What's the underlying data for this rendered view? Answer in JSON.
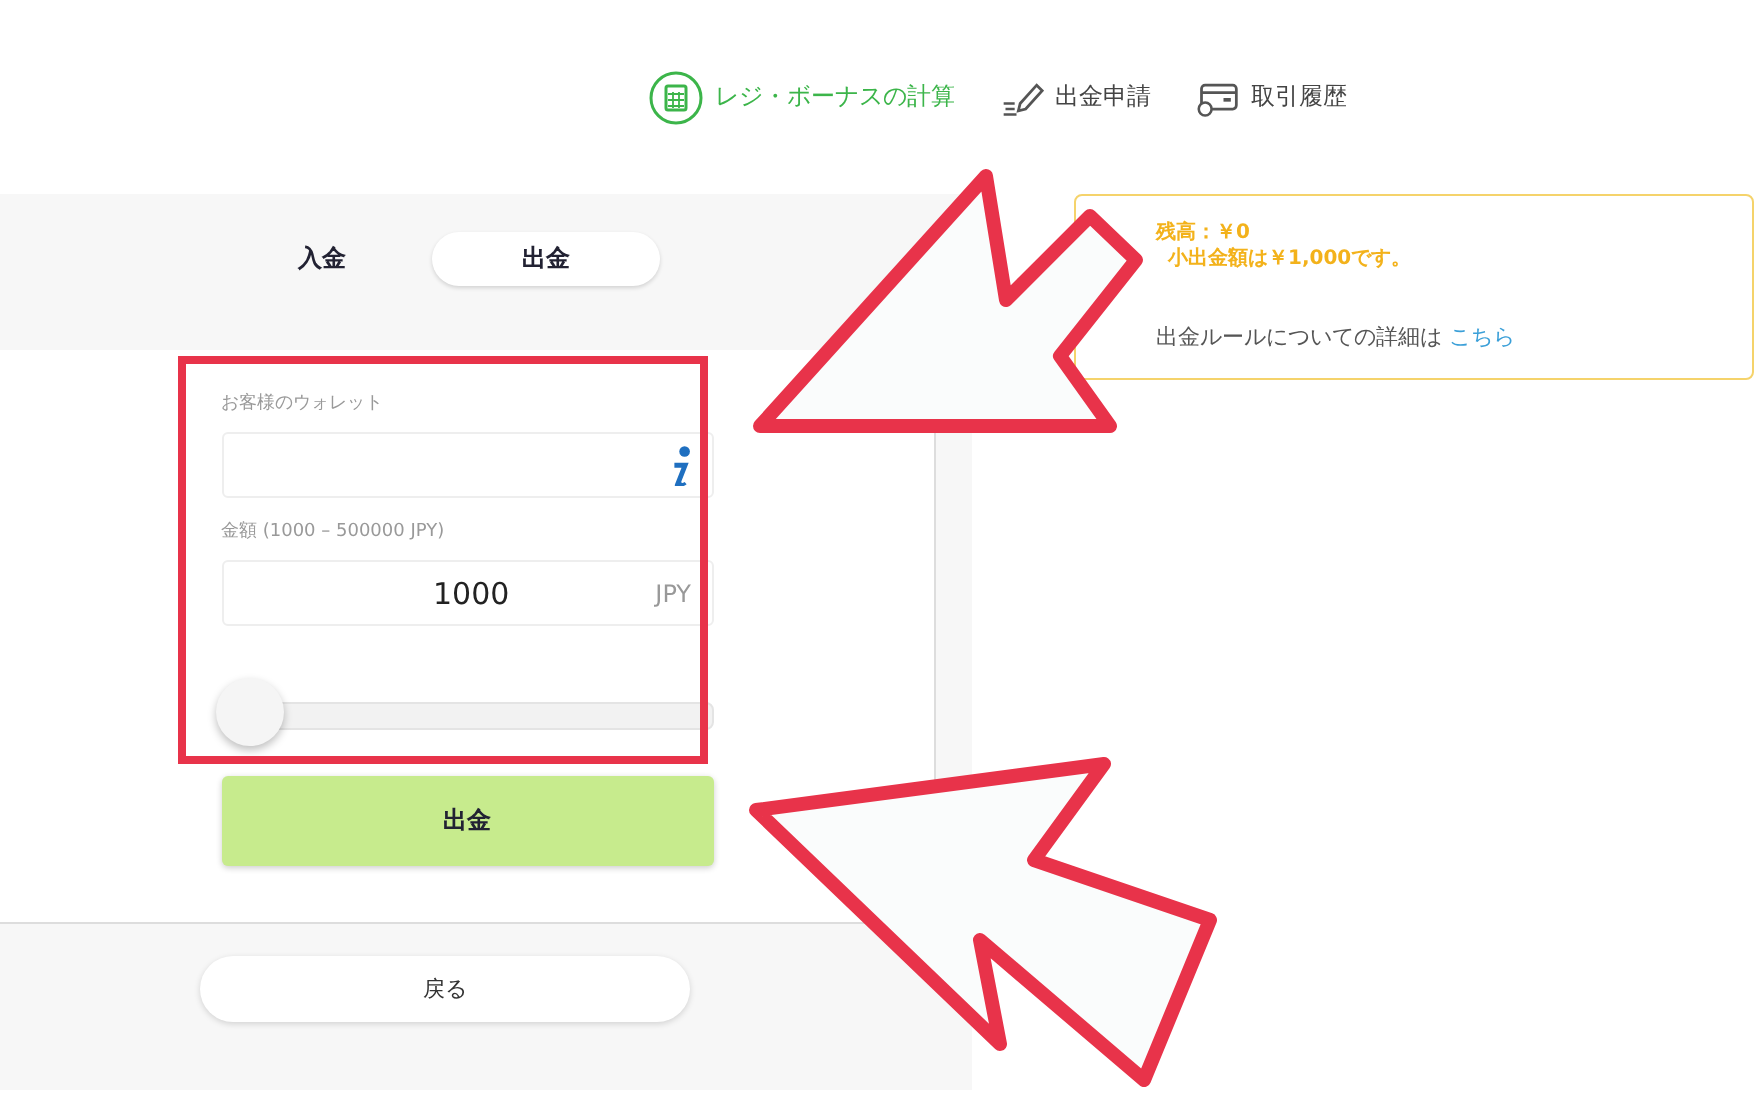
{
  "nav": [
    {
      "label": "レジ・ボーナスの計算",
      "kind": "calculator",
      "selected": true
    },
    {
      "label": "出金申請",
      "kind": "pencil",
      "selected": false
    },
    {
      "label": "取引履歴",
      "kind": "card",
      "selected": false
    }
  ],
  "tabs": [
    {
      "label": "入金",
      "selected": false
    },
    {
      "label": "出金",
      "selected": true
    }
  ],
  "wallet": {
    "label": "お客様のウォレット"
  },
  "amount": {
    "label": "金額 (1000 – 500000 JPY)",
    "value": "1000",
    "unit": "JPY"
  },
  "slider": {
    "level": 0
  },
  "submit": "出金",
  "back": "戻る",
  "info": {
    "balance": "残高：￥0",
    "minimum": "小出金額は￥1,000です。",
    "rule": "出金ルールについての詳細は",
    "link": "こちら"
  }
}
